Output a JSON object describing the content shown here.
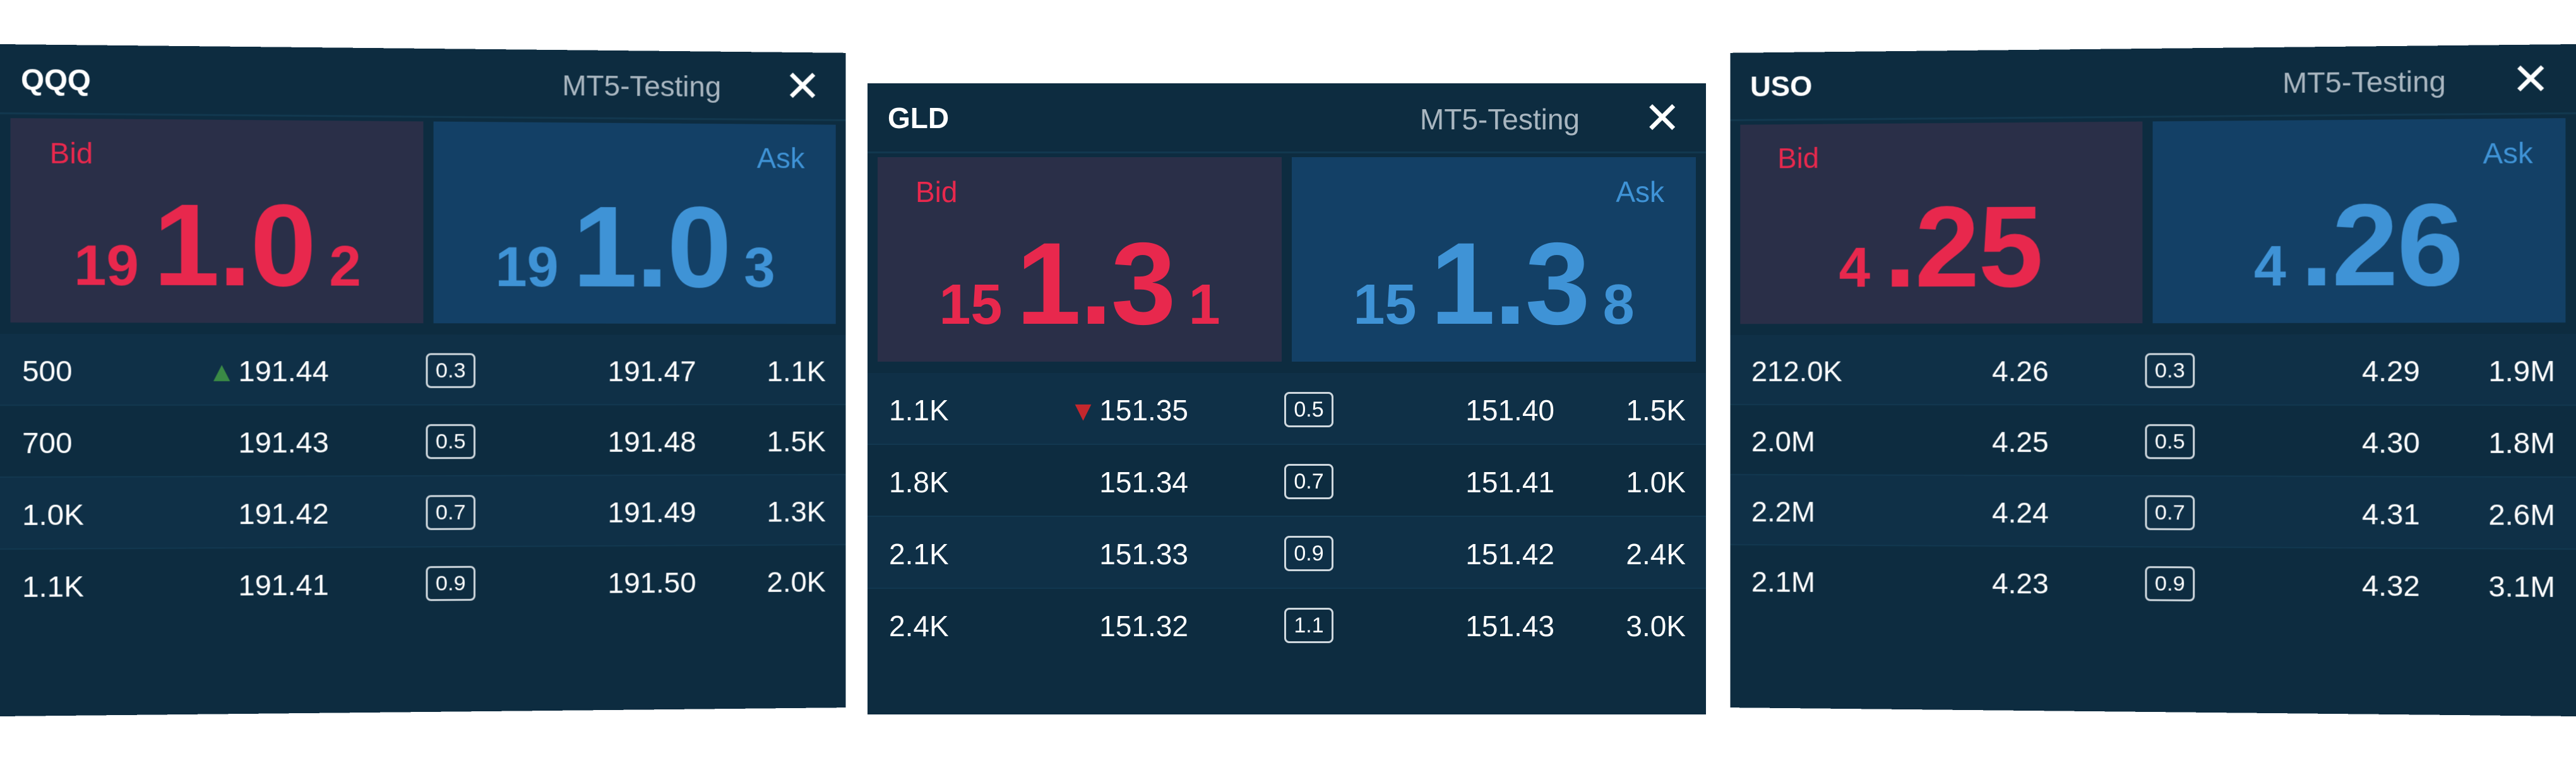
{
  "panels": [
    {
      "symbol": "QQQ",
      "account": "MT5-Testing",
      "close_icon": "close-icon",
      "bid": {
        "label": "Bid",
        "pre": "19",
        "big": "1.0",
        "post": "2"
      },
      "ask": {
        "label": "Ask",
        "pre": "19",
        "big": "1.0",
        "post": "3"
      },
      "rows": [
        {
          "bid_size": "500",
          "bid": "191.44",
          "arrow": "▲",
          "spread": "0.3",
          "ask": "191.47",
          "ask_size": "1.1K"
        },
        {
          "bid_size": "700",
          "bid": "191.43",
          "arrow": "",
          "spread": "0.5",
          "ask": "191.48",
          "ask_size": "1.5K"
        },
        {
          "bid_size": "1.0K",
          "bid": "191.42",
          "arrow": "",
          "spread": "0.7",
          "ask": "191.49",
          "ask_size": "1.3K"
        },
        {
          "bid_size": "1.1K",
          "bid": "191.41",
          "arrow": "",
          "spread": "0.9",
          "ask": "191.50",
          "ask_size": "2.0K"
        }
      ]
    },
    {
      "symbol": "GLD",
      "account": "MT5-Testing",
      "close_icon": "close-icon",
      "bid": {
        "label": "Bid",
        "pre": "15",
        "big": "1.3",
        "post": "1"
      },
      "ask": {
        "label": "Ask",
        "pre": "15",
        "big": "1.3",
        "post": "8"
      },
      "rows": [
        {
          "bid_size": "1.1K",
          "bid": "151.35",
          "arrow": "▼",
          "spread": "0.5",
          "ask": "151.40",
          "ask_size": "1.5K"
        },
        {
          "bid_size": "1.8K",
          "bid": "151.34",
          "arrow": "",
          "spread": "0.7",
          "ask": "151.41",
          "ask_size": "1.0K"
        },
        {
          "bid_size": "2.1K",
          "bid": "151.33",
          "arrow": "",
          "spread": "0.9",
          "ask": "151.42",
          "ask_size": "2.4K"
        },
        {
          "bid_size": "2.4K",
          "bid": "151.32",
          "arrow": "",
          "spread": "1.1",
          "ask": "151.43",
          "ask_size": "3.0K"
        }
      ]
    },
    {
      "symbol": "USO",
      "account": "MT5-Testing",
      "close_icon": "close-icon",
      "bid": {
        "label": "Bid",
        "pre": "4",
        "big": ".25",
        "post": ""
      },
      "ask": {
        "label": "Ask",
        "pre": "4",
        "big": ".26",
        "post": ""
      },
      "rows": [
        {
          "bid_size": "212.0K",
          "bid": "4.26",
          "arrow": "",
          "spread": "0.3",
          "ask": "4.29",
          "ask_size": "1.9M"
        },
        {
          "bid_size": "2.0M",
          "bid": "4.25",
          "arrow": "",
          "spread": "0.5",
          "ask": "4.30",
          "ask_size": "1.8M"
        },
        {
          "bid_size": "2.2M",
          "bid": "4.24",
          "arrow": "",
          "spread": "0.7",
          "ask": "4.31",
          "ask_size": "2.6M"
        },
        {
          "bid_size": "2.1M",
          "bid": "4.23",
          "arrow": "",
          "spread": "0.9",
          "ask": "4.32",
          "ask_size": "3.1M"
        }
      ]
    }
  ],
  "colors": {
    "panel_bg": "#0d2c40",
    "bid_bg": "#2a2f48",
    "ask_bg": "#134066",
    "bid_text": "#e8284d",
    "ask_text": "#3f93d6",
    "up_arrow": "#3a8a45",
    "down_arrow": "#c4272d"
  }
}
